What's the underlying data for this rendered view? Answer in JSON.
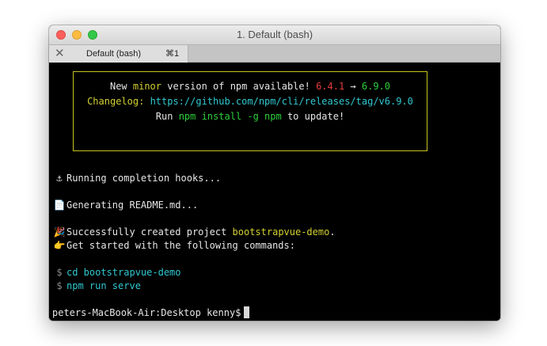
{
  "window": {
    "title": "1. Default (bash)"
  },
  "tab": {
    "close": "✕",
    "label": "Default (bash)",
    "shortcut": "⌘1"
  },
  "notice": {
    "line1": {
      "pre": "New ",
      "minor": "minor",
      "mid": " version of npm available! ",
      "old": "6.4.1",
      "arrow": " → ",
      "new": "6.9.0"
    },
    "line2": {
      "label": "Changelog:",
      "url": "https://github.com/npm/cli/releases/tag/v6.9.0"
    },
    "line3": {
      "pre": "Run ",
      "cmd": "npm install -g npm",
      "post": " to update!"
    }
  },
  "output": {
    "hooks": {
      "icon": "⚓",
      "text": "Running completion hooks..."
    },
    "readme": {
      "icon": "📄",
      "text": "Generating README.md..."
    },
    "success": {
      "icon": "🎉",
      "pre": "Successfully created project ",
      "project": "bootstrapvue-demo",
      "post": "."
    },
    "started": {
      "icon": "👉",
      "text": "Get started with the following commands:"
    },
    "cmd1": {
      "prompt": "$",
      "text": "cd bootstrapvue-demo"
    },
    "cmd2": {
      "prompt": "$",
      "text": "npm run serve"
    }
  },
  "prompt": "peters-MacBook-Air:Desktop kenny$",
  "colors": {
    "yellow": "#d2cf2f",
    "red": "#e43b3b",
    "green": "#2dcf3b",
    "cyan": "#2fc8d0"
  }
}
